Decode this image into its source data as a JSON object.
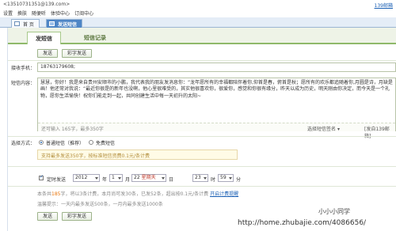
{
  "header": {
    "email": "<13510731351@139.com>",
    "mail_link": "139邮箱",
    "menu": [
      "设置",
      "换肤",
      "随便听",
      "体验中心",
      "订阅中心"
    ]
  },
  "tabs": [
    {
      "label": "首 页",
      "active": false
    },
    {
      "label": "发送短信",
      "active": true
    }
  ],
  "sub_tabs": [
    {
      "label": "发短信",
      "active": true
    },
    {
      "label": "短信记录",
      "active": false
    }
  ],
  "buttons": {
    "send": "发送",
    "color_send": "彩字发送"
  },
  "receiver": {
    "label": "接收手机：",
    "value": "18763179608;"
  },
  "content": {
    "label": "短信内容：",
    "text": "慧慧，你好！我是来自贵州安顺市的小鹏，我代表我的朋友发消息你：“龙年愿所有的幸福都陪伴着你,仰首是春，俯首是秋；愿所有的欢乐都追随着你,月圆是诗，月缺是画！他还常对我说：“最近你很是的新年也没啊，他心里很难受的，其实他很喜欢你，很爱你，感觉和你很有缘分，昨天以成为历史，明天刚由你决定，而今天是一个礼物，愿你生活愉快！祝你们能走到一起，共同创建生活中每一天初升的太阳~",
    "counter": "还可输入 165字，最多350字",
    "signature": "选择短信签名",
    "sender": "[发自139邮箱]"
  },
  "send_mode": {
    "label": "选择方式：",
    "options": [
      {
        "label": "普通短信（推荐）",
        "selected": true
      },
      {
        "label": "免费短信",
        "selected": false
      }
    ],
    "note": "支持最多发送350字，按标准短信资费0.1元/条计费"
  },
  "schedule": {
    "checked": true,
    "label": "定时发送",
    "year": "2012",
    "year_unit": "年",
    "month": "1",
    "month_unit": "月",
    "day": "22",
    "day_unit": "日",
    "weekday": "星期天",
    "hour": "23",
    "hour_unit": "时",
    "minute": "59",
    "minute_unit": "分"
  },
  "info": {
    "line1_a": "本条共",
    "line1_chars": "185",
    "line1_b": "字，将以3条计费，本月尚可发",
    "line1_c": "条，已发52条，超出按0.1元/条计费",
    "line1_link": "开启计费提醒",
    "line2": "温馨提示：一天内最多发送500条，一月内最多发送1000条",
    "month_quota": "30"
  },
  "watermark": {
    "name": "小小小同学",
    "url": "http://home.zhubajie.com/4086656/"
  }
}
